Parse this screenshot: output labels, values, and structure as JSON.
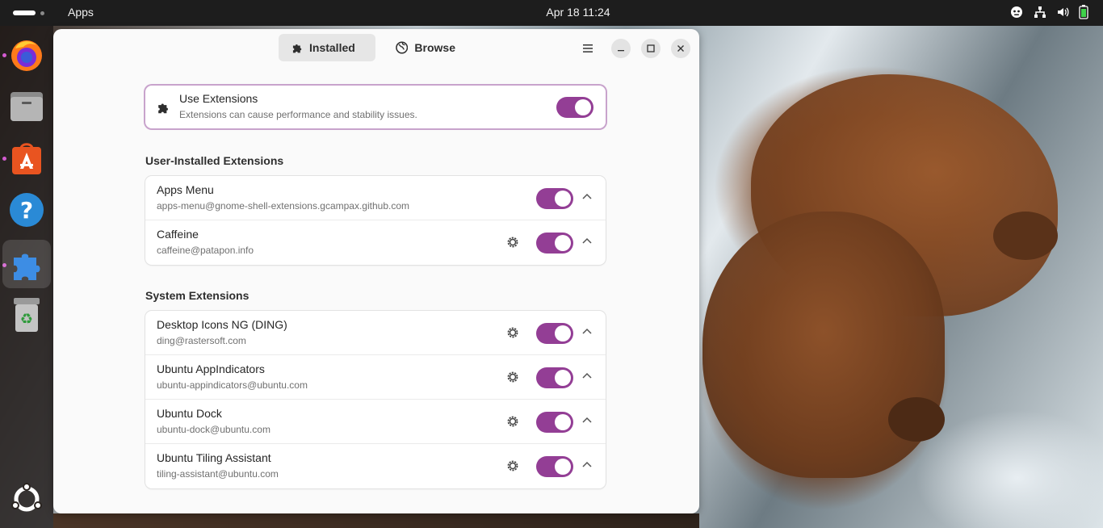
{
  "topbar": {
    "app_name": "Apps",
    "clock": "Apr 18  11:24",
    "tray_icons": [
      "accessibility-icon",
      "network-icon",
      "volume-icon",
      "battery-icon"
    ]
  },
  "dock": {
    "items": [
      {
        "name": "firefox",
        "running": true
      },
      {
        "name": "files",
        "running": false
      },
      {
        "name": "app-center",
        "running": true
      },
      {
        "name": "help",
        "running": false
      },
      {
        "name": "extension-manager",
        "running": true,
        "active": true
      },
      {
        "name": "trash",
        "running": false
      },
      {
        "name": "show-apps",
        "running": false
      }
    ]
  },
  "window": {
    "tabs": [
      {
        "label": "Installed",
        "icon": "puzzle-icon",
        "active": true
      },
      {
        "label": "Browse",
        "icon": "globe-icon",
        "active": false
      }
    ],
    "use_extensions": {
      "title": "Use Extensions",
      "subtitle": "Extensions can cause performance and stability issues.",
      "enabled": true
    },
    "user_section_title": "User-Installed Extensions",
    "user_extensions": [
      {
        "title": "Apps Menu",
        "subtitle": "apps-menu@gnome-shell-extensions.gcampax.github.com",
        "has_settings": false,
        "enabled": true
      },
      {
        "title": "Caffeine",
        "subtitle": "caffeine@patapon.info",
        "has_settings": true,
        "enabled": true
      }
    ],
    "system_section_title": "System Extensions",
    "system_extensions": [
      {
        "title": "Desktop Icons NG (DING)",
        "subtitle": "ding@rastersoft.com",
        "has_settings": true,
        "enabled": true
      },
      {
        "title": "Ubuntu AppIndicators",
        "subtitle": "ubuntu-appindicators@ubuntu.com",
        "has_settings": true,
        "enabled": true
      },
      {
        "title": "Ubuntu Dock",
        "subtitle": "ubuntu-dock@ubuntu.com",
        "has_settings": true,
        "enabled": true
      },
      {
        "title": "Ubuntu Tiling Assistant",
        "subtitle": "tiling-assistant@ubuntu.com",
        "has_settings": true,
        "enabled": true
      }
    ]
  },
  "colors": {
    "accent": "#933e95",
    "topbar": "#1d1d1d"
  }
}
